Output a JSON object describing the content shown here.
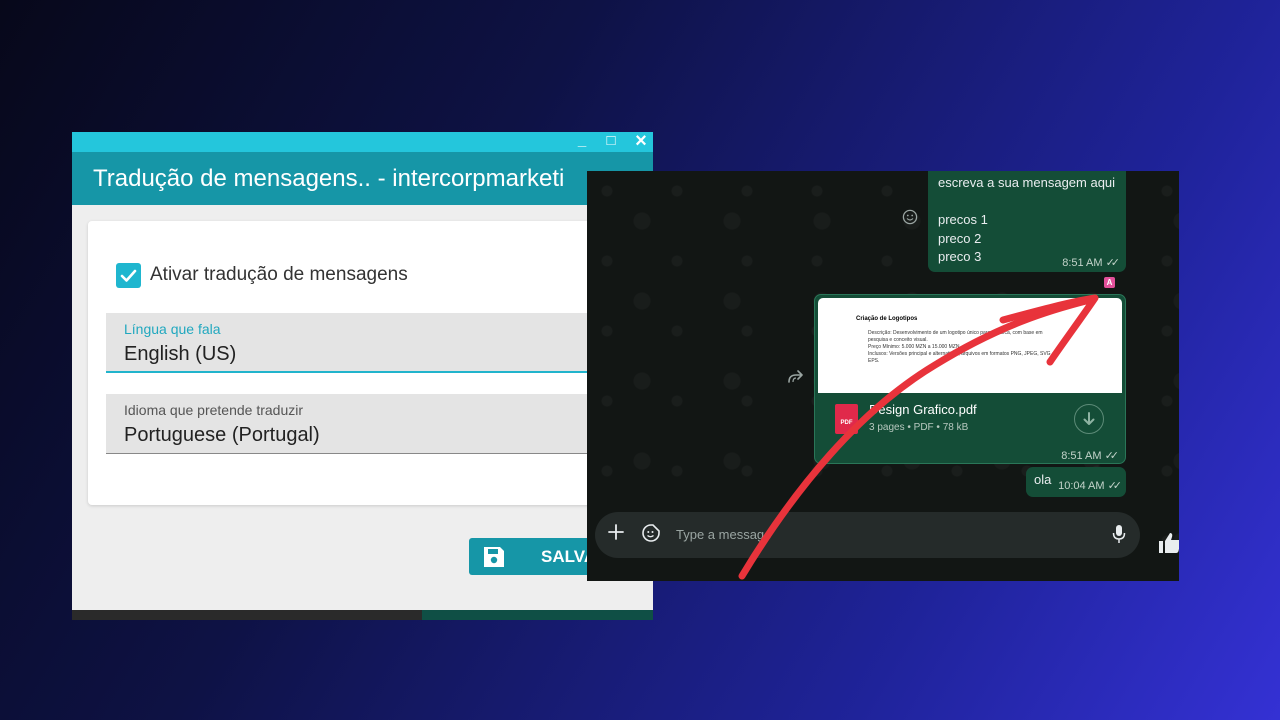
{
  "dialog": {
    "title": "Tradução de mensagens.. - intercorpmarketi",
    "window_controls": {
      "minimize": "_",
      "maximize": "□",
      "close": "×"
    },
    "checkbox": {
      "label": "Ativar tradução de mensagens",
      "checked": true
    },
    "field_speak": {
      "label": "Língua que fala",
      "value": "English (US)"
    },
    "field_translate": {
      "label": "Idioma que pretende traduzir",
      "value": "Portuguese (Portugal)"
    },
    "save_button": {
      "label": "SALVA",
      "icon": "floppy-disk-icon"
    },
    "colors": {
      "accent": "#1fb6cf",
      "titlebar": "#1696a7"
    }
  },
  "chat": {
    "messages": [
      {
        "lines": [
          "escreva a sua mensagem aqui",
          "",
          "precos 1",
          "preco 2",
          "preco 3"
        ],
        "time": "8:51 AM",
        "ticks": "✓✓"
      },
      {
        "type": "document",
        "preview": {
          "title": "Criação de Logotipos",
          "bullets": [
            "Descrição: Desenvolvimento de um logotipo único para a marca, com base em",
            "pesquisa e conceito visual.",
            "Preço Mínimo: 5.000 MZN a 15.000 MZN",
            "Inclusos: Versões principal e alternativas, arquivos em formatos PNG, JPEG, SVG e",
            "EPS."
          ]
        },
        "file_name": "Design Grafico.pdf",
        "file_meta": "3 pages • PDF • 78 kB",
        "pdf_badge": "PDF",
        "time": "8:51 AM",
        "ticks": "✓✓"
      },
      {
        "text": "ola",
        "time": "10:04 AM",
        "ticks": "✓✓"
      }
    ],
    "badge": "A",
    "composer": {
      "placeholder": "Type a message"
    },
    "colors": {
      "bubble": "#144d37",
      "background": "#121614",
      "arrow": "#e8333b"
    }
  }
}
